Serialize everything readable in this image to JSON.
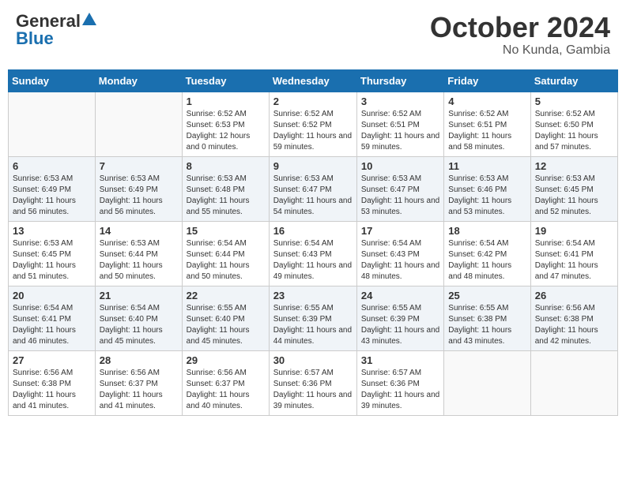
{
  "header": {
    "logo_general": "General",
    "logo_blue": "Blue",
    "month_title": "October 2024",
    "location": "No Kunda, Gambia"
  },
  "weekdays": [
    "Sunday",
    "Monday",
    "Tuesday",
    "Wednesday",
    "Thursday",
    "Friday",
    "Saturday"
  ],
  "weeks": [
    [
      {
        "day": "",
        "sunrise": "",
        "sunset": "",
        "daylight": ""
      },
      {
        "day": "",
        "sunrise": "",
        "sunset": "",
        "daylight": ""
      },
      {
        "day": "1",
        "sunrise": "Sunrise: 6:52 AM",
        "sunset": "Sunset: 6:53 PM",
        "daylight": "Daylight: 12 hours and 0 minutes."
      },
      {
        "day": "2",
        "sunrise": "Sunrise: 6:52 AM",
        "sunset": "Sunset: 6:52 PM",
        "daylight": "Daylight: 11 hours and 59 minutes."
      },
      {
        "day": "3",
        "sunrise": "Sunrise: 6:52 AM",
        "sunset": "Sunset: 6:51 PM",
        "daylight": "Daylight: 11 hours and 59 minutes."
      },
      {
        "day": "4",
        "sunrise": "Sunrise: 6:52 AM",
        "sunset": "Sunset: 6:51 PM",
        "daylight": "Daylight: 11 hours and 58 minutes."
      },
      {
        "day": "5",
        "sunrise": "Sunrise: 6:52 AM",
        "sunset": "Sunset: 6:50 PM",
        "daylight": "Daylight: 11 hours and 57 minutes."
      }
    ],
    [
      {
        "day": "6",
        "sunrise": "Sunrise: 6:53 AM",
        "sunset": "Sunset: 6:49 PM",
        "daylight": "Daylight: 11 hours and 56 minutes."
      },
      {
        "day": "7",
        "sunrise": "Sunrise: 6:53 AM",
        "sunset": "Sunset: 6:49 PM",
        "daylight": "Daylight: 11 hours and 56 minutes."
      },
      {
        "day": "8",
        "sunrise": "Sunrise: 6:53 AM",
        "sunset": "Sunset: 6:48 PM",
        "daylight": "Daylight: 11 hours and 55 minutes."
      },
      {
        "day": "9",
        "sunrise": "Sunrise: 6:53 AM",
        "sunset": "Sunset: 6:47 PM",
        "daylight": "Daylight: 11 hours and 54 minutes."
      },
      {
        "day": "10",
        "sunrise": "Sunrise: 6:53 AM",
        "sunset": "Sunset: 6:47 PM",
        "daylight": "Daylight: 11 hours and 53 minutes."
      },
      {
        "day": "11",
        "sunrise": "Sunrise: 6:53 AM",
        "sunset": "Sunset: 6:46 PM",
        "daylight": "Daylight: 11 hours and 53 minutes."
      },
      {
        "day": "12",
        "sunrise": "Sunrise: 6:53 AM",
        "sunset": "Sunset: 6:45 PM",
        "daylight": "Daylight: 11 hours and 52 minutes."
      }
    ],
    [
      {
        "day": "13",
        "sunrise": "Sunrise: 6:53 AM",
        "sunset": "Sunset: 6:45 PM",
        "daylight": "Daylight: 11 hours and 51 minutes."
      },
      {
        "day": "14",
        "sunrise": "Sunrise: 6:53 AM",
        "sunset": "Sunset: 6:44 PM",
        "daylight": "Daylight: 11 hours and 50 minutes."
      },
      {
        "day": "15",
        "sunrise": "Sunrise: 6:54 AM",
        "sunset": "Sunset: 6:44 PM",
        "daylight": "Daylight: 11 hours and 50 minutes."
      },
      {
        "day": "16",
        "sunrise": "Sunrise: 6:54 AM",
        "sunset": "Sunset: 6:43 PM",
        "daylight": "Daylight: 11 hours and 49 minutes."
      },
      {
        "day": "17",
        "sunrise": "Sunrise: 6:54 AM",
        "sunset": "Sunset: 6:43 PM",
        "daylight": "Daylight: 11 hours and 48 minutes."
      },
      {
        "day": "18",
        "sunrise": "Sunrise: 6:54 AM",
        "sunset": "Sunset: 6:42 PM",
        "daylight": "Daylight: 11 hours and 48 minutes."
      },
      {
        "day": "19",
        "sunrise": "Sunrise: 6:54 AM",
        "sunset": "Sunset: 6:41 PM",
        "daylight": "Daylight: 11 hours and 47 minutes."
      }
    ],
    [
      {
        "day": "20",
        "sunrise": "Sunrise: 6:54 AM",
        "sunset": "Sunset: 6:41 PM",
        "daylight": "Daylight: 11 hours and 46 minutes."
      },
      {
        "day": "21",
        "sunrise": "Sunrise: 6:54 AM",
        "sunset": "Sunset: 6:40 PM",
        "daylight": "Daylight: 11 hours and 45 minutes."
      },
      {
        "day": "22",
        "sunrise": "Sunrise: 6:55 AM",
        "sunset": "Sunset: 6:40 PM",
        "daylight": "Daylight: 11 hours and 45 minutes."
      },
      {
        "day": "23",
        "sunrise": "Sunrise: 6:55 AM",
        "sunset": "Sunset: 6:39 PM",
        "daylight": "Daylight: 11 hours and 44 minutes."
      },
      {
        "day": "24",
        "sunrise": "Sunrise: 6:55 AM",
        "sunset": "Sunset: 6:39 PM",
        "daylight": "Daylight: 11 hours and 43 minutes."
      },
      {
        "day": "25",
        "sunrise": "Sunrise: 6:55 AM",
        "sunset": "Sunset: 6:38 PM",
        "daylight": "Daylight: 11 hours and 43 minutes."
      },
      {
        "day": "26",
        "sunrise": "Sunrise: 6:56 AM",
        "sunset": "Sunset: 6:38 PM",
        "daylight": "Daylight: 11 hours and 42 minutes."
      }
    ],
    [
      {
        "day": "27",
        "sunrise": "Sunrise: 6:56 AM",
        "sunset": "Sunset: 6:38 PM",
        "daylight": "Daylight: 11 hours and 41 minutes."
      },
      {
        "day": "28",
        "sunrise": "Sunrise: 6:56 AM",
        "sunset": "Sunset: 6:37 PM",
        "daylight": "Daylight: 11 hours and 41 minutes."
      },
      {
        "day": "29",
        "sunrise": "Sunrise: 6:56 AM",
        "sunset": "Sunset: 6:37 PM",
        "daylight": "Daylight: 11 hours and 40 minutes."
      },
      {
        "day": "30",
        "sunrise": "Sunrise: 6:57 AM",
        "sunset": "Sunset: 6:36 PM",
        "daylight": "Daylight: 11 hours and 39 minutes."
      },
      {
        "day": "31",
        "sunrise": "Sunrise: 6:57 AM",
        "sunset": "Sunset: 6:36 PM",
        "daylight": "Daylight: 11 hours and 39 minutes."
      },
      {
        "day": "",
        "sunrise": "",
        "sunset": "",
        "daylight": ""
      },
      {
        "day": "",
        "sunrise": "",
        "sunset": "",
        "daylight": ""
      }
    ]
  ]
}
